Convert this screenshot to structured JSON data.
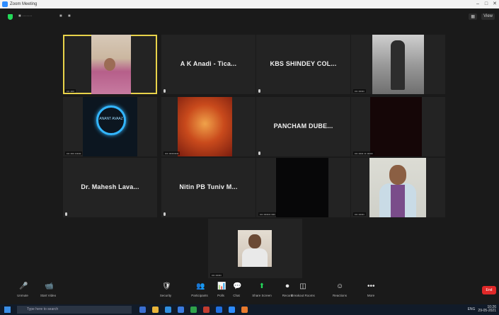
{
  "window": {
    "title": "Zoom Meeting",
    "controls": [
      "–",
      "□",
      "✕"
    ]
  },
  "topbar": {
    "items": [
      "■ ·······",
      "■",
      "■"
    ],
    "view_label": "View"
  },
  "participants": [
    {
      "name": "",
      "tag": "••• ••••",
      "video": "person1",
      "active": true
    },
    {
      "name": "A K Anadi - Tica...",
      "tag": "",
      "video": "none"
    },
    {
      "name": "KBS SHINDEY COL...",
      "tag": "",
      "video": "none"
    },
    {
      "name": "",
      "tag": "••• ••••••",
      "video": "soldier"
    },
    {
      "name": "",
      "tag": "••• •••• ••••••",
      "video": "logo",
      "logo_text": "ANANT AVAAZ"
    },
    {
      "name": "",
      "tag": "••• ••••••••••",
      "video": "god"
    },
    {
      "name": "PANCHAM DUBE...",
      "tag": "",
      "video": "none"
    },
    {
      "name": "",
      "tag": "••• ••••• •• ••••••",
      "video": "dark"
    },
    {
      "name": "Dr. Mahesh Lava...",
      "tag": "",
      "video": "none"
    },
    {
      "name": "Nitin PB Tuniv M...",
      "tag": "",
      "video": "none"
    },
    {
      "name": "",
      "tag": "••• ••••••• ••••",
      "video": "black"
    },
    {
      "name": "",
      "tag": "••• ••••••",
      "video": "man"
    },
    {
      "name": "",
      "tag": "••• ••••••",
      "video": "person-last"
    }
  ],
  "toolbar": {
    "buttons": [
      {
        "icon": "🎤",
        "label": "Unmute"
      },
      {
        "icon": "📹",
        "label": "Start Video"
      },
      {
        "icon": "🛡",
        "label": "Security"
      },
      {
        "icon": "👥",
        "label": "Participants"
      },
      {
        "icon": "📊",
        "label": "Polls"
      },
      {
        "icon": "💬",
        "label": "Chat"
      },
      {
        "icon": "⬆",
        "label": "Share Screen"
      },
      {
        "icon": "⏺",
        "label": "Record"
      },
      {
        "icon": "◫",
        "label": "Breakout Rooms"
      },
      {
        "icon": "☺",
        "label": "Reactions"
      },
      {
        "icon": "•••",
        "label": "More"
      }
    ],
    "end_label": "End"
  },
  "taskbar": {
    "search_placeholder": "Type here to search",
    "icons": [
      "#3b6fd1",
      "#e8b43a",
      "#2f8fe0",
      "#3a7be0",
      "#2fa24a",
      "#c13b2f",
      "#1f6fe0",
      "#2d8cff",
      "#e87a2d"
    ],
    "tray_text": "ENG",
    "time": "10:26",
    "date": "29-05-2021"
  }
}
